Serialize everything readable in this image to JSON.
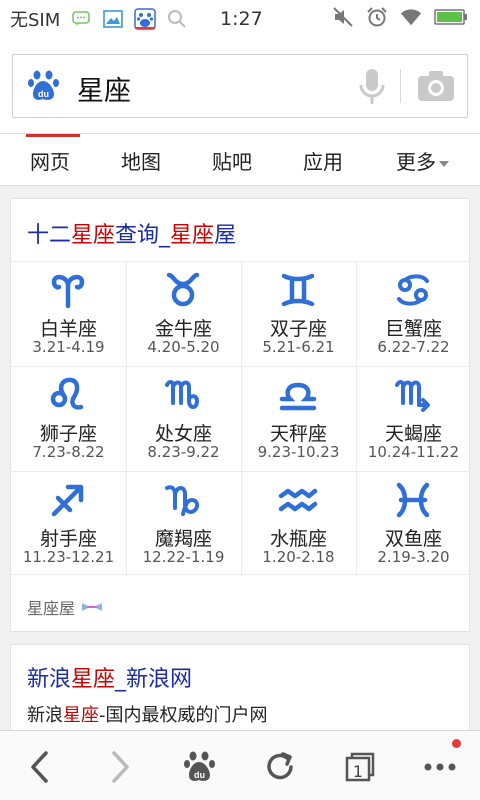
{
  "status_bar": {
    "carrier": "无SIM",
    "time": "1:27",
    "icons": [
      "chat-icon",
      "image-icon",
      "baidu-app-icon",
      "search-icon",
      "mute-icon",
      "alarm-icon",
      "wifi-icon",
      "battery-icon"
    ]
  },
  "search": {
    "query": "星座",
    "logo": "baidu-paw-icon",
    "actions": [
      "mic-icon",
      "camera-icon"
    ]
  },
  "tabs": [
    {
      "label": "网页",
      "active": true
    },
    {
      "label": "地图",
      "active": false
    },
    {
      "label": "贴吧",
      "active": false
    },
    {
      "label": "应用",
      "active": false
    },
    {
      "label": "更多",
      "active": false
    }
  ],
  "result1": {
    "title_parts": [
      "十二",
      "星座",
      "查询_",
      "星座",
      "屋"
    ],
    "zodiac": [
      {
        "name": "白羊座",
        "dates": "3.21-4.19",
        "symbol": "aries-icon"
      },
      {
        "name": "金牛座",
        "dates": "4.20-5.20",
        "symbol": "taurus-icon"
      },
      {
        "name": "双子座",
        "dates": "5.21-6.21",
        "symbol": "gemini-icon"
      },
      {
        "name": "巨蟹座",
        "dates": "6.22-7.22",
        "symbol": "cancer-icon"
      },
      {
        "name": "狮子座",
        "dates": "7.23-8.22",
        "symbol": "leo-icon"
      },
      {
        "name": "处女座",
        "dates": "8.23-9.22",
        "symbol": "virgo-icon"
      },
      {
        "name": "天秤座",
        "dates": "9.23-10.23",
        "symbol": "libra-icon"
      },
      {
        "name": "天蝎座",
        "dates": "10.24-11.22",
        "symbol": "scorpio-icon"
      },
      {
        "name": "射手座",
        "dates": "11.23-12.21",
        "symbol": "sagittarius-icon"
      },
      {
        "name": "魔羯座",
        "dates": "12.22-1.19",
        "symbol": "capricorn-icon"
      },
      {
        "name": "水瓶座",
        "dates": "1.20-2.18",
        "symbol": "aquarius-icon"
      },
      {
        "name": "双鱼座",
        "dates": "2.19-3.20",
        "symbol": "pisces-icon"
      }
    ],
    "source": "星座屋"
  },
  "result2": {
    "title_parts": [
      "新浪",
      "星座",
      "_新浪网"
    ],
    "desc_parts": [
      "新浪",
      "星座",
      "-国内最权威的门户网"
    ]
  },
  "bottom_bar": {
    "tab_count": "1",
    "icons": [
      "back-icon",
      "forward-icon",
      "baidu-home-icon",
      "refresh-icon",
      "tabs-icon",
      "more-icon"
    ]
  },
  "colors": {
    "link": "#1a2aa8",
    "highlight": "#c00000",
    "zodiac_symbol": "#2f6fd6",
    "active_tab": "#d43030"
  }
}
